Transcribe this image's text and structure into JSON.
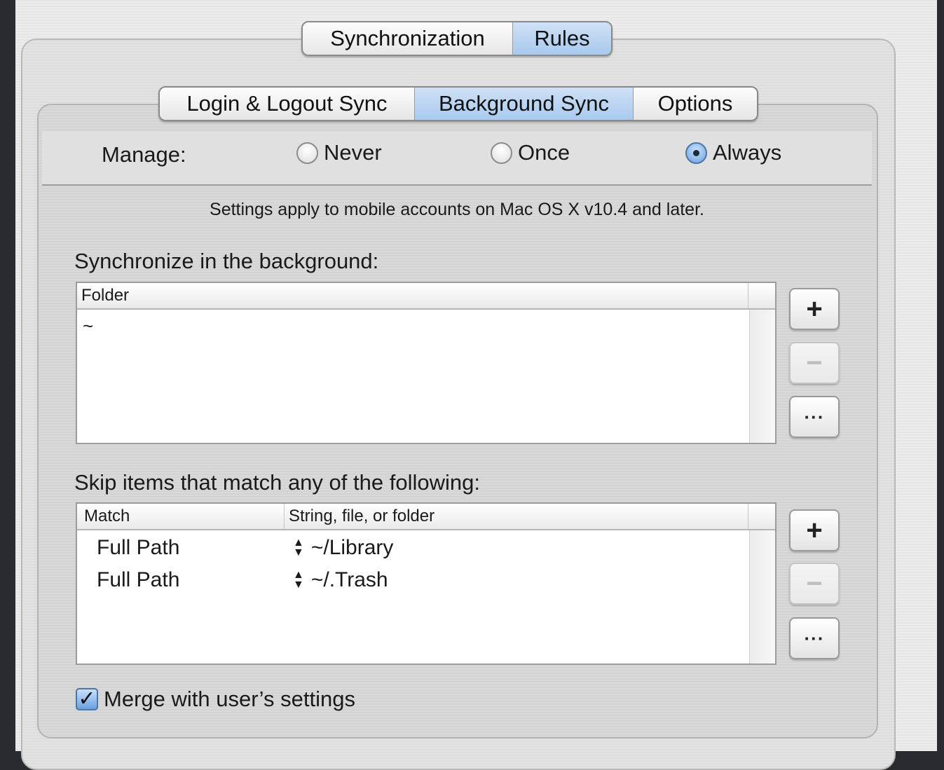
{
  "top_tabs": [
    "Synchronization",
    "Rules"
  ],
  "top_tabs_active": "Rules",
  "sub_tabs": [
    "Login & Logout Sync",
    "Background Sync",
    "Options"
  ],
  "sub_tabs_active": "Background Sync",
  "manage": {
    "label": "Manage:",
    "options": [
      "Never",
      "Once",
      "Always"
    ],
    "selected": "Always"
  },
  "note": "Settings apply to mobile accounts on Mac OS X v10.4 and later.",
  "background": {
    "label": "Synchronize in the background:",
    "columns": [
      "Folder"
    ],
    "rows": [
      "~"
    ]
  },
  "skip": {
    "label": "Skip items that match any of the following:",
    "columns": [
      "Match",
      "String, file, or folder"
    ],
    "rows": [
      {
        "match": "Full Path",
        "value": "~/Library"
      },
      {
        "match": "Full Path",
        "value": "~/.Trash"
      }
    ]
  },
  "buttons": {
    "add": "+",
    "remove": "−",
    "more": "···"
  },
  "merge": {
    "label": "Merge with user’s settings",
    "checked": true
  },
  "colors": {
    "accent": "#a9c9ee",
    "background": "#2a2b2f"
  },
  "icons": {
    "checkmark": "check-icon"
  }
}
